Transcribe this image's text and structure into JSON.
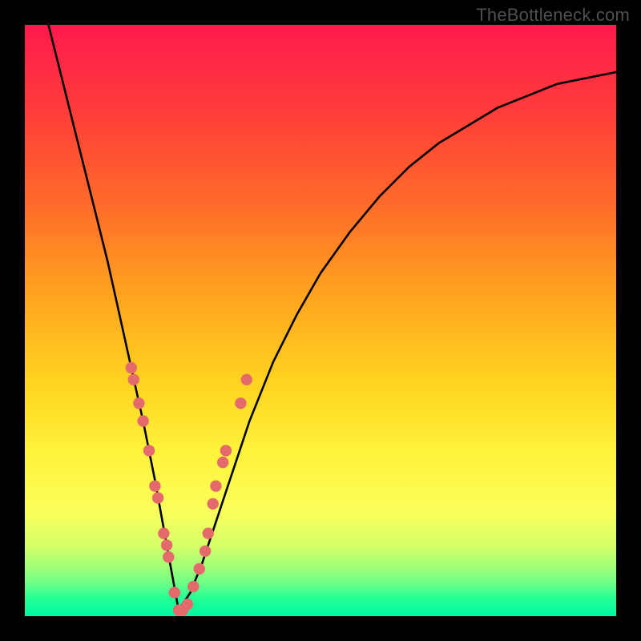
{
  "watermark": "TheBottleneck.com",
  "colors": {
    "frame": "#000000",
    "curve": "#000000",
    "dot": "#e46a6b",
    "gradient_top": "#ff1a4d",
    "gradient_bottom": "#00f9a0"
  },
  "chart_data": {
    "type": "line",
    "title": "",
    "xlabel": "",
    "ylabel": "",
    "xlim": [
      0,
      100
    ],
    "ylim": [
      0,
      100
    ],
    "note": "Axes are percentage-normalized to the plot area; no tick labels are shown in the source image, so values are estimated visually. y=0 is at the bottom (best / green), y=100 at the top (worst / red). The main curve is a V-shaped bottleneck curve reaching ~0 at x≈26.",
    "series": [
      {
        "name": "bottleneck-curve",
        "x": [
          4,
          6,
          8,
          10,
          12,
          14,
          16,
          18,
          20,
          22,
          24,
          26,
          28,
          30,
          32,
          34,
          36,
          38,
          42,
          46,
          50,
          55,
          60,
          65,
          70,
          75,
          80,
          85,
          90,
          95,
          100
        ],
        "y": [
          100,
          92,
          84,
          76,
          68,
          60,
          51,
          42,
          33,
          23,
          12,
          1,
          4,
          9,
          15,
          21,
          27,
          33,
          43,
          51,
          58,
          65,
          71,
          76,
          80,
          83,
          86,
          88,
          90,
          91,
          92
        ]
      }
    ],
    "scatter": {
      "name": "highlighted-points",
      "note": "pink dots clustered along the lower V of the curve",
      "points": [
        {
          "x": 18.0,
          "y": 42
        },
        {
          "x": 18.4,
          "y": 40
        },
        {
          "x": 19.3,
          "y": 36
        },
        {
          "x": 20.0,
          "y": 33
        },
        {
          "x": 21.0,
          "y": 28
        },
        {
          "x": 22.0,
          "y": 22
        },
        {
          "x": 22.5,
          "y": 20
        },
        {
          "x": 23.5,
          "y": 14
        },
        {
          "x": 24.0,
          "y": 12
        },
        {
          "x": 24.3,
          "y": 10
        },
        {
          "x": 25.3,
          "y": 4
        },
        {
          "x": 26.0,
          "y": 1
        },
        {
          "x": 26.7,
          "y": 1
        },
        {
          "x": 27.5,
          "y": 2
        },
        {
          "x": 28.5,
          "y": 5
        },
        {
          "x": 29.5,
          "y": 8
        },
        {
          "x": 30.5,
          "y": 11
        },
        {
          "x": 31.0,
          "y": 14
        },
        {
          "x": 31.8,
          "y": 19
        },
        {
          "x": 32.3,
          "y": 22
        },
        {
          "x": 33.5,
          "y": 26
        },
        {
          "x": 34.0,
          "y": 28
        },
        {
          "x": 36.5,
          "y": 36
        },
        {
          "x": 37.5,
          "y": 40
        }
      ]
    }
  }
}
